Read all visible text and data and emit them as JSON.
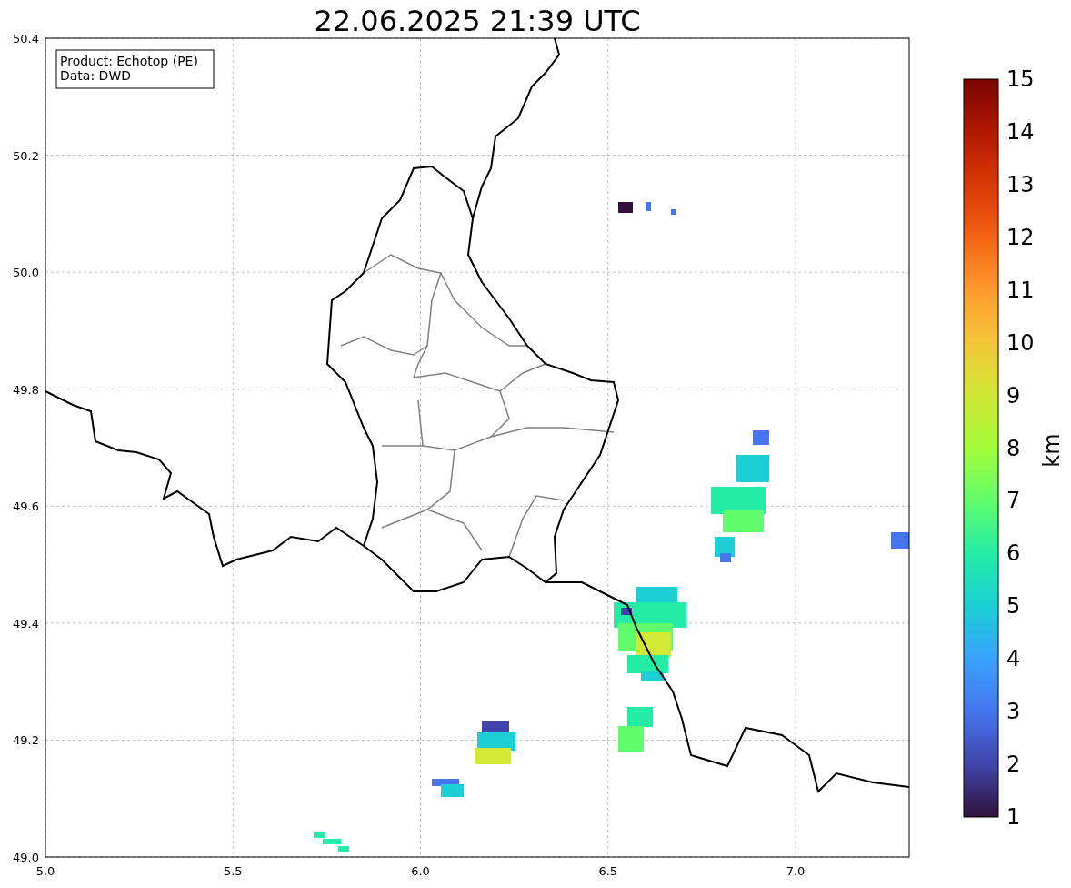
{
  "title": "22.06.2025 21:39 UTC",
  "legend": [
    "Product: Echotop (PE)",
    "Data: DWD"
  ],
  "x_ticks": [
    "5.0",
    "5.5",
    "6.0",
    "6.5",
    "7.0"
  ],
  "y_ticks": [
    "50.4",
    "50.2",
    "50.0",
    "49.8",
    "49.6",
    "49.4",
    "49.2",
    "49.0"
  ],
  "colorbar": {
    "label": "km",
    "ticks": [
      "15",
      "14",
      "13",
      "12",
      "11",
      "10",
      "9",
      "8",
      "7",
      "6",
      "5",
      "4",
      "3",
      "2",
      "1"
    ]
  }
}
